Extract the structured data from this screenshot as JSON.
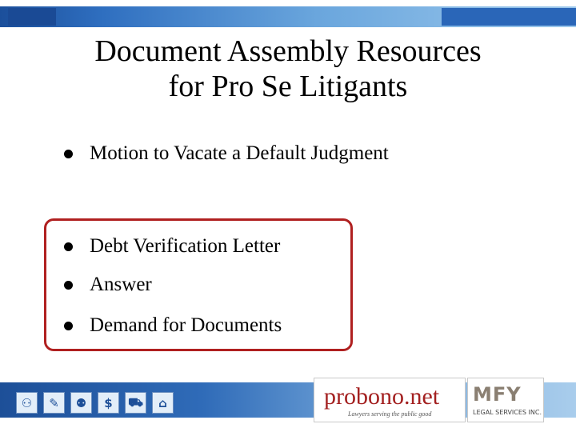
{
  "title": {
    "line1": "Document Assembly Resources",
    "line2": "for Pro Se Litigants"
  },
  "bullets": [
    "Motion to Vacate a Default Judgment",
    "Debt Verification Letter",
    "Answer",
    "Demand for Documents"
  ],
  "footer": {
    "icons": [
      "family-icon",
      "tag-icon",
      "people-walking-icon",
      "dollar-icon",
      "tractor-icon",
      "house-icon"
    ],
    "icon_glyphs": [
      "⚇",
      "✎",
      "⚉",
      "$",
      "⛟",
      "⌂"
    ],
    "probono": {
      "name": "probono.net",
      "tagline": "Lawyers serving the public good"
    },
    "mfy": {
      "mark": "MFY",
      "sub": "LEGAL SERVICES INC."
    }
  },
  "colors": {
    "accent_red": "#b02020",
    "banner_blue": "#1d4f98"
  }
}
